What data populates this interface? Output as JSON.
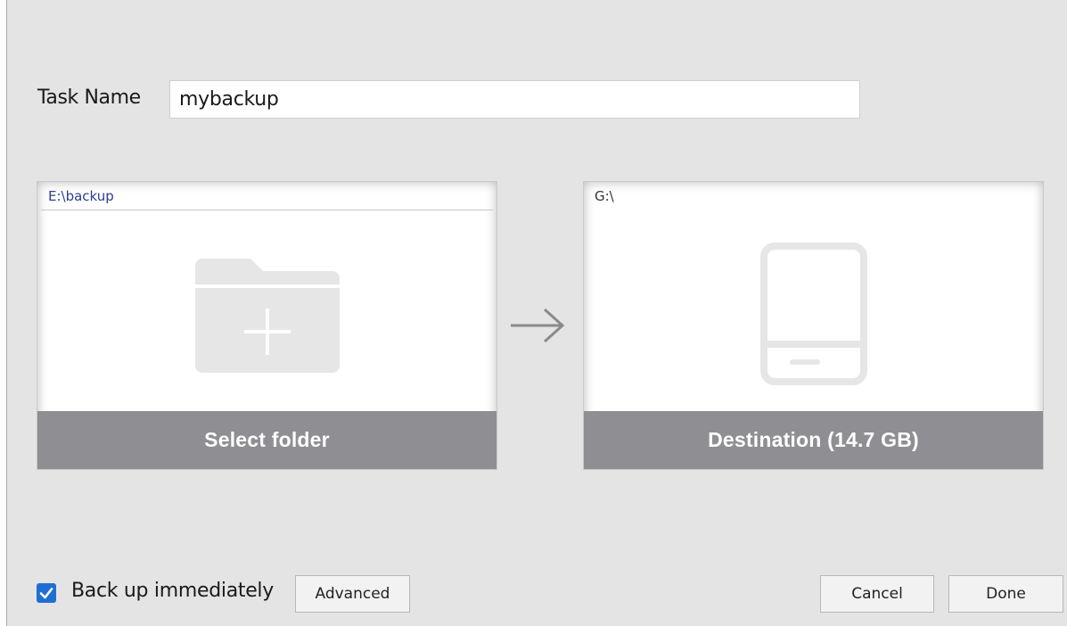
{
  "task": {
    "label": "Task Name",
    "value": "mybackup"
  },
  "source": {
    "path": "E:\\backup",
    "button_label": "Select folder",
    "icon": "folder-add-icon"
  },
  "destination": {
    "path": "G:\\",
    "button_label": "Destination (14.7 GB)",
    "icon": "drive-icon"
  },
  "arrow_icon": "arrow-right-icon",
  "options": {
    "backup_immediately_label": "Back up immediately",
    "backup_immediately_checked": true
  },
  "buttons": {
    "advanced": "Advanced",
    "cancel": "Cancel",
    "done": "Done"
  },
  "colors": {
    "accent": "#1f6fd1",
    "card_footer": "#8f8f93",
    "icon_gray": "#e6e6e6",
    "background": "#e4e4e4"
  }
}
